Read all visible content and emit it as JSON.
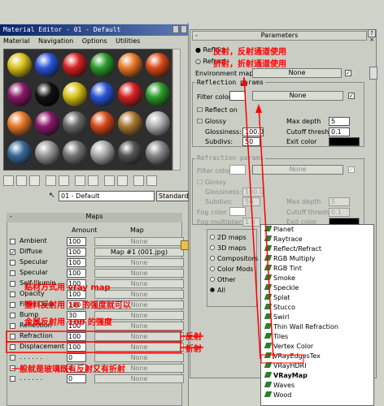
{
  "material_editor": {
    "title": "Material Editor - 01 - Default",
    "menu": [
      "Material",
      "Navigation",
      "Options",
      "Utilities"
    ],
    "material_name": "01 - Default",
    "material_type": "Standard",
    "sphere_colors": [
      "#d8c21a",
      "#2b55d8",
      "#d42222",
      "#2c9a2c",
      "#e7792a",
      "#d84a1a",
      "#8a1a6a",
      "#111111",
      "#d8c21a",
      "#2b55d8",
      "#d42222",
      "#2c9a2c",
      "#e7792a",
      "#8a1a6a",
      "#6a6a6a",
      "#d84a1a",
      "#aa7733",
      "#b0b0b0",
      "#3a6a9a",
      "#999999",
      "#777777",
      "#aaaaaa",
      "#555555",
      "#888888"
    ]
  },
  "maps": {
    "title": "Maps",
    "col_amount": "Amount",
    "col_map": "Map",
    "rows": [
      {
        "name": "Ambient",
        "amount": "100",
        "map": "None",
        "checked": false,
        "set": false
      },
      {
        "name": "Diffuse",
        "amount": "100",
        "map": "Map #1 (001.jpg)",
        "checked": true,
        "set": true
      },
      {
        "name": "Specular",
        "amount": "100",
        "map": "None",
        "checked": false,
        "set": false
      },
      {
        "name": "Specular",
        "amount": "100",
        "map": "None",
        "checked": false,
        "set": false
      },
      {
        "name": "Self-Illumin",
        "amount": "100",
        "map": "None",
        "checked": false,
        "set": false
      },
      {
        "name": "Opacity",
        "amount": "100",
        "map": "None",
        "checked": false,
        "set": false
      },
      {
        "name": "Filter Color",
        "amount": "100",
        "map": "None",
        "checked": false,
        "set": false
      },
      {
        "name": "Bump",
        "amount": "30",
        "map": "None",
        "checked": false,
        "set": false
      },
      {
        "name": "Reflection",
        "amount": "100",
        "map": "None",
        "checked": false,
        "set": false
      },
      {
        "name": "Refraction",
        "amount": "100",
        "map": "None",
        "checked": false,
        "set": false
      },
      {
        "name": "Displacement",
        "amount": "100",
        "map": "None",
        "checked": false,
        "set": false
      },
      {
        "name": ". . . . . .",
        "amount": "0",
        "map": "None",
        "checked": false,
        "set": false
      },
      {
        "name": ". . . . . .",
        "amount": "0",
        "map": "None",
        "checked": false,
        "set": false
      },
      {
        "name": ". . . . . .",
        "amount": "0",
        "map": "None",
        "checked": false,
        "set": false
      }
    ]
  },
  "annotations": {
    "reflect": "反射，反射通道使用",
    "refract": "折射，折射通道使用",
    "line1": "贴材方式用 vray map",
    "line2": "塑料反射用 10 的强度就可以",
    "line3": "金属反射用 100 的强度",
    "bottom": "一般就是玻璃既有反射又有折射",
    "label_reflect": "反射",
    "label_refract": "折射"
  },
  "params": {
    "title": "Parameters",
    "reflect_radio": "Reflect",
    "refract_radio": "Refract",
    "environment_map": "Environment map:",
    "env_none": "None",
    "reflection_group": "Reflection params",
    "filter_color": "Filter color:",
    "filter_none": "None",
    "reflect_on": "Reflect on",
    "glossy": "Glossy",
    "max_depth": "Max depth",
    "max_depth_val": "5",
    "glossiness": "Glossiness:",
    "glossiness_val": "100.0",
    "cutoff": "Cutoff thresh",
    "cutoff_val": "0.1",
    "subdivs": "Subdivs:",
    "subdivs_val": "50",
    "exit_color": "Exit color",
    "refraction_group": "Refraction params",
    "r_filter_color": "Filter color:",
    "r_filter_none": "None",
    "r_glossy": "Glossy",
    "r_glossiness": "Glossiness:",
    "r_glossiness_val": "100.0",
    "r_subdivs": "Subdivs:",
    "r_subdivs_val": "50",
    "r_max_depth": "Max depth",
    "r_max_depth_val": "5",
    "r_cutoff": "Cutoff thresh",
    "r_cutoff_val": "0.1",
    "fog_color": "Fog color",
    "fog_mult": "Fog multiplier",
    "fog_mult_val": "1.0",
    "r_exit_color": "Exit color"
  },
  "browser": {
    "radios": [
      "2D maps",
      "3D maps",
      "Compositors",
      "Color Mods",
      "Other",
      "All"
    ],
    "items": [
      "Planet",
      "Raytrace",
      "Reflect/Refract",
      "RGB Multiply",
      "RGB Tint",
      "Smoke",
      "Speckle",
      "Splat",
      "Stucco",
      "Swirl",
      "Thin Wall Refraction",
      "Tiles",
      "Vertex Color",
      "VRayEdgesTex",
      "VRayHDRI",
      "VRayMap",
      "Waves",
      "Wood"
    ],
    "selected": "VRayMap"
  }
}
